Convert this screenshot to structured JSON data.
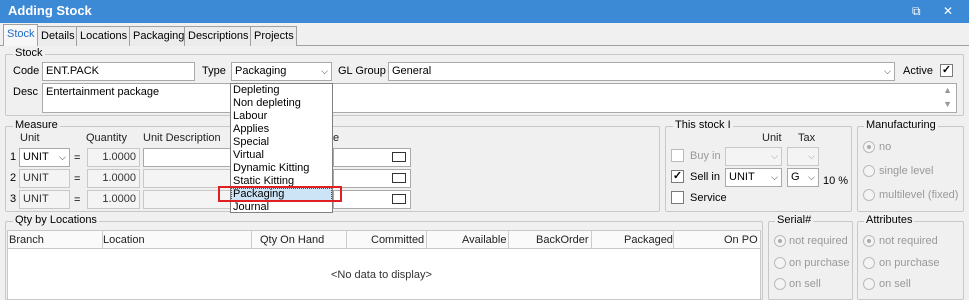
{
  "window": {
    "title": "Adding Stock",
    "restore_glyph": "⧉",
    "close_glyph": "✕"
  },
  "tabs": [
    "Stock",
    "Details",
    "Locations",
    "Packaging",
    "Descriptions",
    "Projects"
  ],
  "stock_group": {
    "label": "Stock",
    "code_label": "Code",
    "code_value": "ENT.PACK",
    "type_label": "Type",
    "type_value": "Packaging",
    "gl_label": "GL Group",
    "gl_value": "General",
    "active_label": "Active",
    "active_checked": "✓",
    "desc_label": "Desc",
    "desc_value": "Entertainment package"
  },
  "type_dropdown": {
    "options": [
      "Depleting",
      "Non depleting",
      "Labour",
      "Applies",
      "Special",
      "Virtual",
      "Dynamic Kitting",
      "Static Kitting",
      "Packaging",
      "Journal"
    ],
    "highlighted": "Packaging"
  },
  "measure": {
    "label": "Measure",
    "col_unit": "Unit",
    "col_quantity": "Quantity",
    "col_desc": "Unit Description",
    "col_barcode_partial": "e",
    "rows": [
      {
        "num": "1",
        "unit": "UNIT",
        "eq": "=",
        "qty": "1.0000"
      },
      {
        "num": "2",
        "unit": "UNIT",
        "eq": "=",
        "qty": "1.0000"
      },
      {
        "num": "3",
        "unit": "UNIT",
        "eq": "=",
        "qty": "1.0000"
      }
    ]
  },
  "this_stock": {
    "label": "This stock I",
    "col_unit": "Unit",
    "col_tax": "Tax",
    "buy_in": "Buy in",
    "sell_in": "Sell in",
    "service": "Service",
    "sell_checked": "✓",
    "sell_unit": "UNIT",
    "sell_tax": "G",
    "sell_tax_rate": "10 %"
  },
  "manufacturing": {
    "label": "Manufacturing",
    "options": [
      "no",
      "single level",
      "multilevel (fixed)"
    ]
  },
  "qty_locations": {
    "label": "Qty by Locations",
    "columns": [
      "Branch",
      "Location",
      "Qty On Hand",
      "Committed",
      "Available",
      "BackOrder",
      "Packaged",
      "On PO"
    ],
    "empty": "<No data to display>"
  },
  "serial": {
    "label": "Serial#",
    "options": [
      "not required",
      "on purchase",
      "on sell"
    ]
  },
  "attributes": {
    "label": "Attributes",
    "options": [
      "not required",
      "on purchase",
      "on sell"
    ]
  },
  "colors": {
    "titlebar": "#3c8ad6",
    "highlight_border": "#e02020",
    "tab_active_text": "#1e6bc6"
  }
}
